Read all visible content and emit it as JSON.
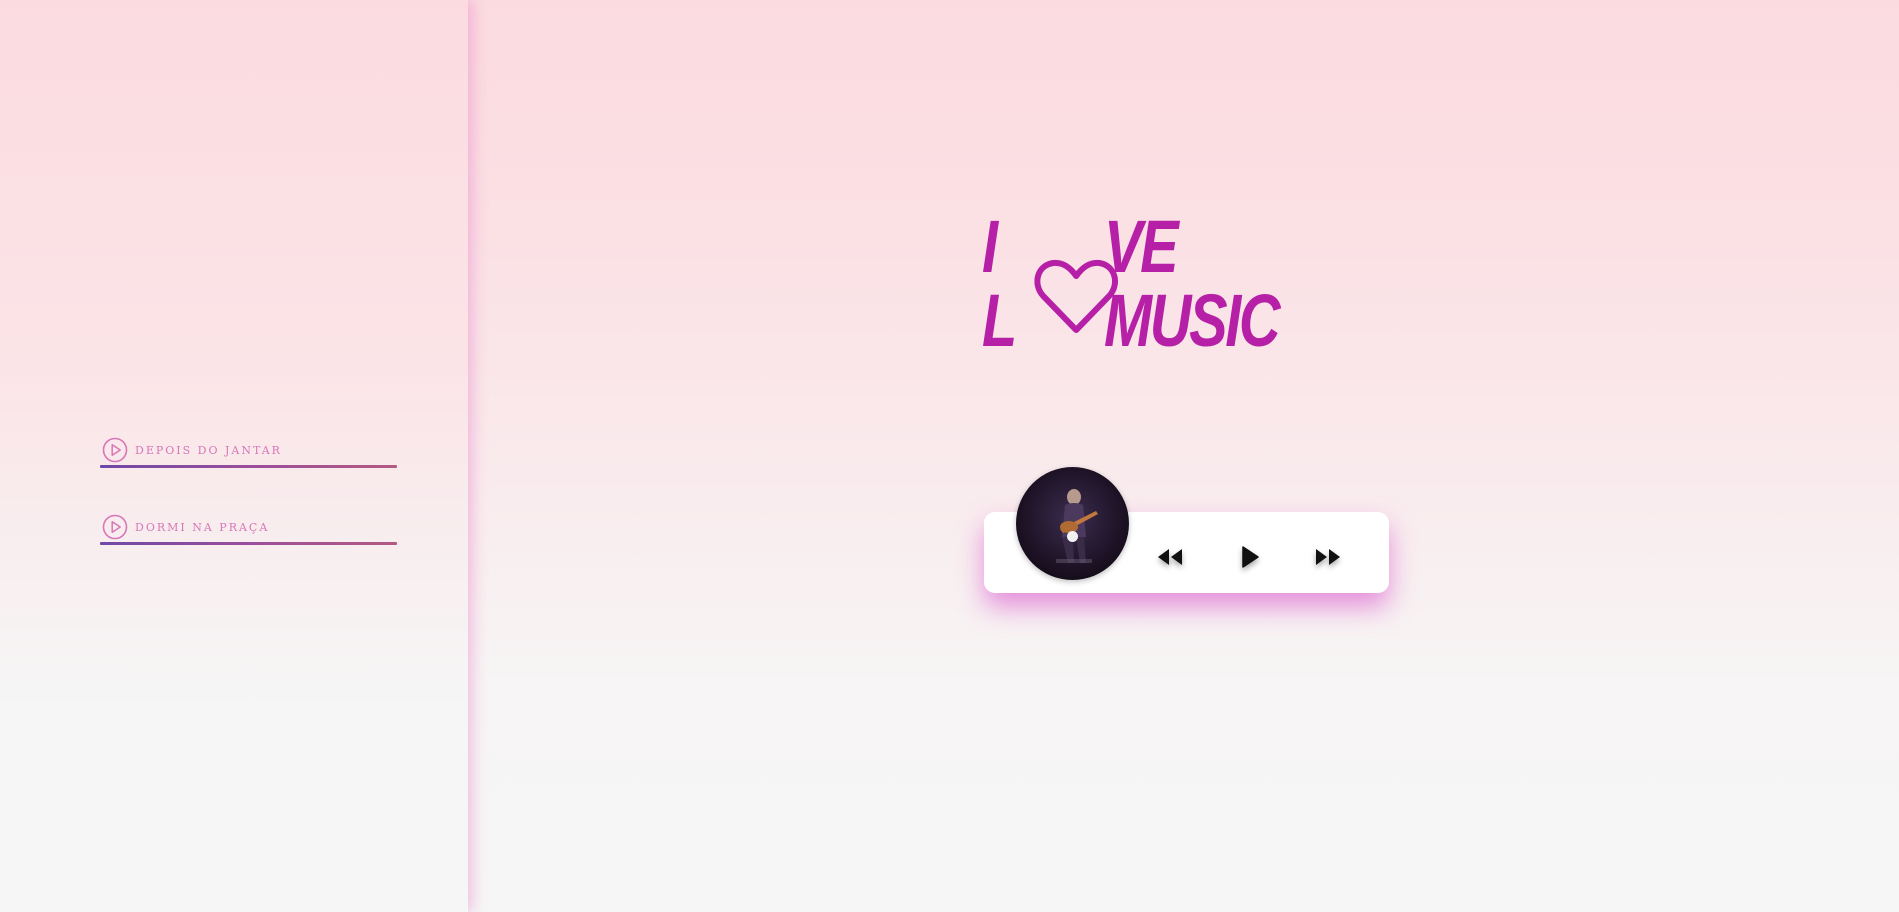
{
  "sidebar": {
    "tracks": [
      {
        "label": "DEPOIS DO JANTAR",
        "icon": "play-circle-icon"
      },
      {
        "label": "DORMI NA PRAÇA",
        "icon": "play-circle-icon"
      }
    ]
  },
  "title": {
    "before_heart": "I L",
    "heart_icon": "heart-outline-icon",
    "after_heart": "VE MUSIC"
  },
  "player": {
    "cover_icon": "album-cover-guitarist",
    "controls": [
      {
        "name": "previous",
        "icon": "rewind-icon"
      },
      {
        "name": "play",
        "icon": "play-icon"
      },
      {
        "name": "next",
        "icon": "fast-forward-icon"
      }
    ]
  },
  "colors": {
    "accent": "#b620a6",
    "track_label": "#d876b8",
    "underline_start": "#6f49a6",
    "underline_end": "#b35a82",
    "player_shadow": "#d542c8"
  }
}
